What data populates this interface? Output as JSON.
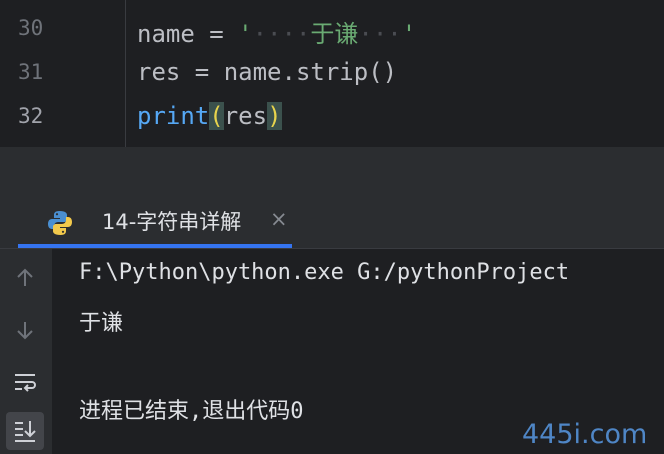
{
  "editor": {
    "lines": [
      {
        "number": "30",
        "var": "name",
        "op": " = ",
        "q1": "'",
        "pad1": "····",
        "text": "于谦",
        "pad2": "···",
        "q2": "'"
      },
      {
        "number": "31",
        "code": "res = name.strip()"
      },
      {
        "number": "32",
        "fn": "print",
        "open": "(",
        "arg": "res",
        "close": ")"
      }
    ]
  },
  "run_panel": {
    "tab_label": "14-字符串详解",
    "close_glyph": "×",
    "toolbar_icons": [
      "arrow-up-icon",
      "arrow-down-icon",
      "soft-wrap-icon",
      "scroll-to-end-icon"
    ]
  },
  "console": {
    "lines": [
      "F:\\Python\\python.exe G:/pythonProject",
      "于谦",
      "",
      "进程已结束,退出代码0"
    ]
  },
  "watermark": "445i.com",
  "colors": {
    "accent": "#3574f0",
    "string": "#6aab73",
    "function": "#56a8f5",
    "bracket_highlight": "#e8d44d"
  }
}
